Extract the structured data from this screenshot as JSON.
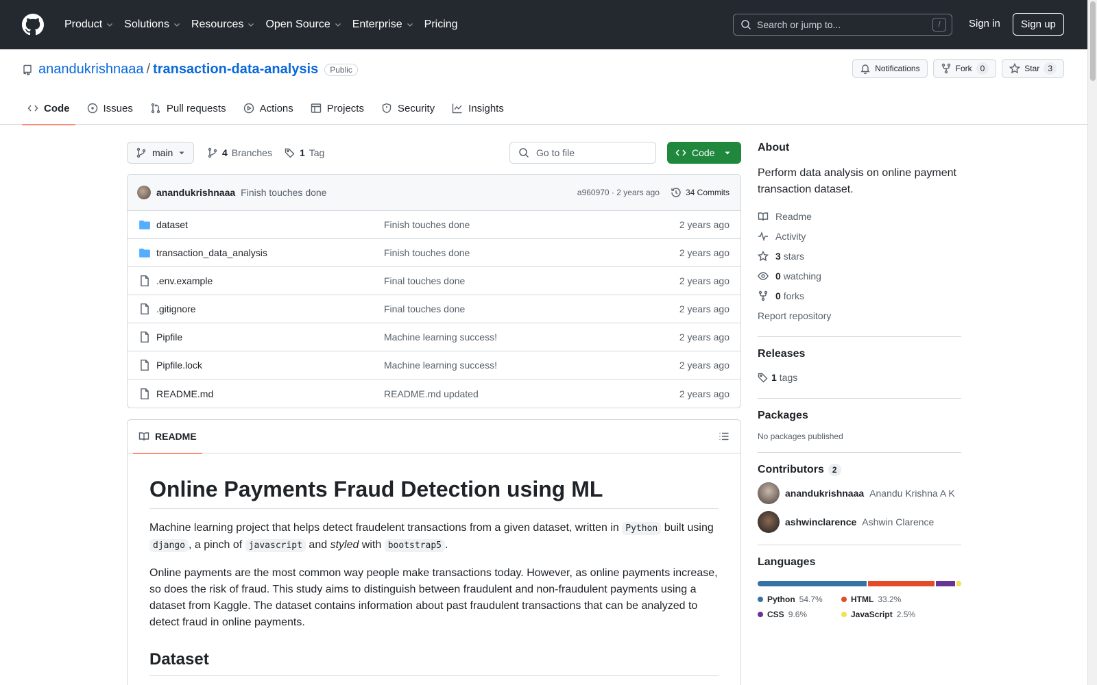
{
  "header": {
    "nav": [
      {
        "label": "Product",
        "has_menu": true
      },
      {
        "label": "Solutions",
        "has_menu": true
      },
      {
        "label": "Resources",
        "has_menu": true
      },
      {
        "label": "Open Source",
        "has_menu": true
      },
      {
        "label": "Enterprise",
        "has_menu": true
      },
      {
        "label": "Pricing",
        "has_menu": false
      }
    ],
    "search_placeholder": "Search or jump to...",
    "search_key": "/",
    "sign_in": "Sign in",
    "sign_up": "Sign up"
  },
  "repo": {
    "owner": "anandukrishnaaa",
    "separator": "/",
    "name": "transaction-data-analysis",
    "visibility": "Public",
    "notifications_label": "Notifications",
    "fork_label": "Fork",
    "fork_count": "0",
    "star_label": "Star",
    "star_count": "3",
    "tabs": [
      {
        "label": "Code",
        "icon": "code-icon",
        "active": true
      },
      {
        "label": "Issues",
        "icon": "issue-icon"
      },
      {
        "label": "Pull requests",
        "icon": "pull-request-icon"
      },
      {
        "label": "Actions",
        "icon": "play-icon"
      },
      {
        "label": "Projects",
        "icon": "table-icon"
      },
      {
        "label": "Security",
        "icon": "shield-icon"
      },
      {
        "label": "Insights",
        "icon": "graph-icon"
      }
    ]
  },
  "toolbar": {
    "branch": "main",
    "branches_count": "4",
    "branches_label": "Branches",
    "tags_count": "1",
    "tags_label": "Tag",
    "goto_placeholder": "Go to file",
    "code_button": "Code"
  },
  "latest_commit": {
    "author": "anandukrishnaaa",
    "message": "Finish touches done",
    "hash_age": "a960970 · 2 years ago",
    "commits": "34 Commits"
  },
  "files": [
    {
      "name": "dataset",
      "type": "folder",
      "commit": "Finish touches done",
      "age": "2 years ago"
    },
    {
      "name": "transaction_data_analysis",
      "type": "folder",
      "commit": "Finish touches done",
      "age": "2 years ago"
    },
    {
      "name": ".env.example",
      "type": "file",
      "commit": "Final touches done",
      "age": "2 years ago"
    },
    {
      "name": ".gitignore",
      "type": "file",
      "commit": "Final touches done",
      "age": "2 years ago"
    },
    {
      "name": "Pipfile",
      "type": "file",
      "commit": "Machine learning success!",
      "age": "2 years ago"
    },
    {
      "name": "Pipfile.lock",
      "type": "file",
      "commit": "Machine learning success!",
      "age": "2 years ago"
    },
    {
      "name": "README.md",
      "type": "file",
      "commit": "README.md updated",
      "age": "2 years ago"
    }
  ],
  "readme": {
    "tab_label": "README",
    "title": "Online Payments Fraud Detection using ML",
    "p1": {
      "t1": "Machine learning project that helps detect fraudelent transactions from a given dataset, written in ",
      "c1": "Python",
      "t2": " built using ",
      "c2": "django",
      "t3": ", a pinch of ",
      "c3": "javascript",
      "t4": " and ",
      "em": "styled",
      "t5": " with ",
      "c4": "bootstrap5",
      "t6": "."
    },
    "p2": "Online payments are the most common way people make transactions today. However, as online payments increase, so does the risk of fraud. This study aims to distinguish between fraudulent and non-fraudulent payments using a dataset from Kaggle. The dataset contains information about past fraudulent transactions that can be analyzed to detect fraud in online payments.",
    "h2": "Dataset"
  },
  "sidebar": {
    "about_title": "About",
    "about_desc": "Perform data analysis on online payment transaction dataset.",
    "links": {
      "readme": "Readme",
      "activity": "Activity",
      "stars_count": "3",
      "stars_label": "stars",
      "watching_count": "0",
      "watching_label": "watching",
      "forks_count": "0",
      "forks_label": "forks",
      "report": "Report repository"
    },
    "releases_title": "Releases",
    "releases_count": "1",
    "releases_label": "tags",
    "packages_title": "Packages",
    "packages_none": "No packages published",
    "contributors_title": "Contributors",
    "contributors_count": "2",
    "contributors": [
      {
        "login": "anandukrishnaaa",
        "name": "Anandu Krishna A K"
      },
      {
        "login": "ashwinclarence",
        "name": "Ashwin Clarence"
      }
    ],
    "languages_title": "Languages",
    "languages": [
      {
        "name": "Python",
        "percent": "54.7%",
        "value": 54.7,
        "color": "#3572A5"
      },
      {
        "name": "HTML",
        "percent": "33.2%",
        "value": 33.2,
        "color": "#e34c26"
      },
      {
        "name": "CSS",
        "percent": "9.6%",
        "value": 9.6,
        "color": "#663399"
      },
      {
        "name": "JavaScript",
        "percent": "2.5%",
        "value": 2.5,
        "color": "#f1e05a"
      }
    ]
  }
}
